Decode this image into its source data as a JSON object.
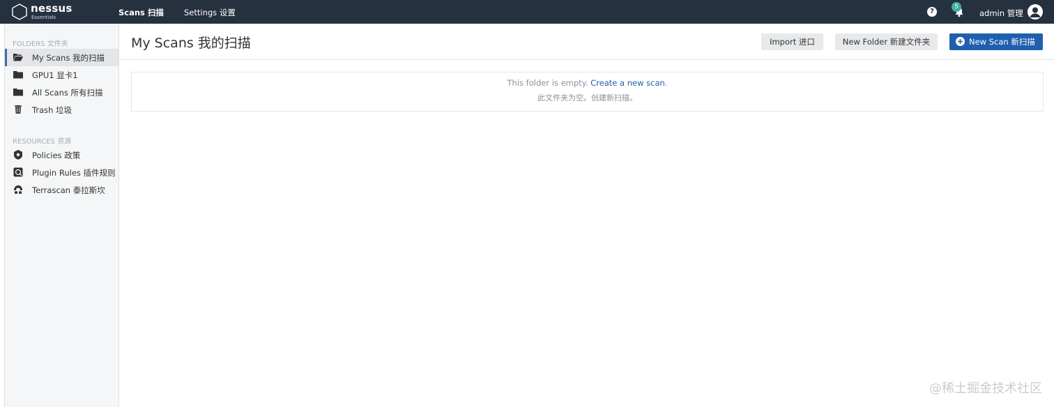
{
  "topbar": {
    "logo_name": "nessus",
    "logo_sub": "Essentials",
    "nav": [
      {
        "label": "Scans 扫描",
        "active": true
      },
      {
        "label": "Settings 设置",
        "active": false
      }
    ],
    "notification_count": "5",
    "user_label": "admin 管理",
    "icons": {
      "help": "question-circle-icon",
      "bell": "bell-icon",
      "user": "user-avatar-icon"
    }
  },
  "sidebar": {
    "folders_label": "FOLDERS 文件夹",
    "folders": [
      {
        "label": "My Scans  我的扫描",
        "icon": "folder-open-icon",
        "active": true
      },
      {
        "label": "GPU1  显卡1",
        "icon": "folder-icon",
        "active": false
      },
      {
        "label": "All Scans  所有扫描",
        "icon": "folder-icon",
        "active": false
      },
      {
        "label": "Trash  垃圾",
        "icon": "trash-icon",
        "active": false
      }
    ],
    "resources_label": "RESOURCES 资源",
    "resources": [
      {
        "label": "Policies 政策",
        "icon": "shield-icon"
      },
      {
        "label": "Plugin Rules 插件规则",
        "icon": "plugin-rules-icon"
      },
      {
        "label": "Terrascan 泰拉斯坎",
        "icon": "terrascan-icon"
      }
    ]
  },
  "main": {
    "title": "My Scans 我的扫描",
    "buttons": {
      "import": "Import 进口",
      "new_folder": "New Folder 新建文件夹",
      "new_scan": "New Scan  新扫描"
    },
    "empty": {
      "text": "This folder is empty. ",
      "link": "Create a new scan",
      "period": ".",
      "translation": "此文件夹为空。创建新扫描。"
    }
  },
  "watermark": "@稀土掘金技术社区",
  "colors": {
    "topbar": "#263140",
    "accent": "#1e5fae",
    "badge": "#3fae9d",
    "sidebar_bg": "#f5f6f7"
  }
}
